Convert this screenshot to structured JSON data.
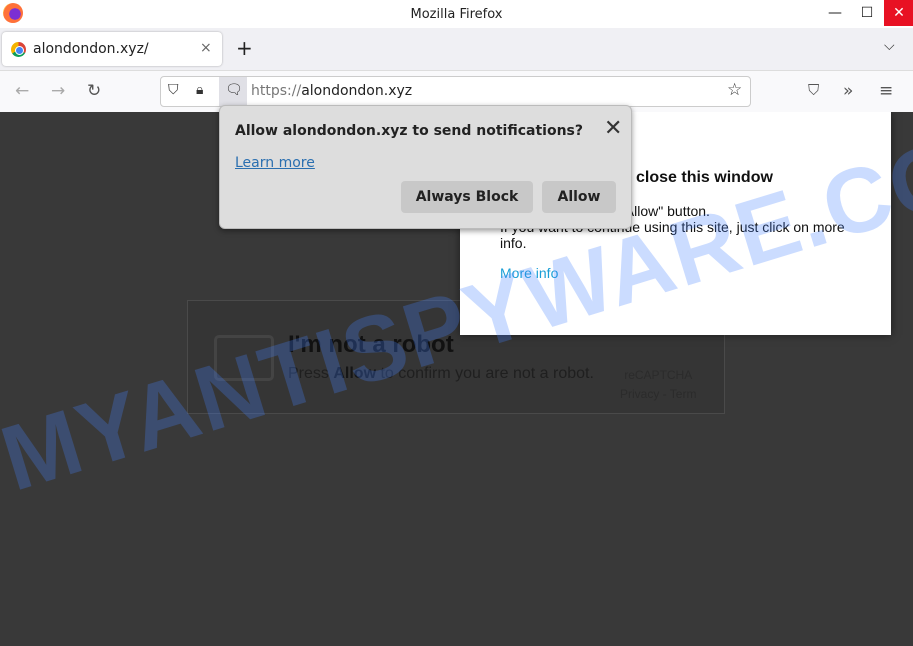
{
  "window": {
    "title": "Mozilla Firefox",
    "controls": {
      "minimize": "—",
      "maximize": "☐",
      "close": "✕"
    }
  },
  "tabs": [
    {
      "label": "alondondon.xyz/",
      "close": "×",
      "favicon": "chrome-icon"
    }
  ],
  "tabstrip": {
    "new_tab": "+",
    "list_all": "⌵"
  },
  "nav": {
    "back": "←",
    "forward": "→",
    "reload": "↻",
    "url_scheme": "https://",
    "url_host": "alondondon.xyz",
    "star": "☆",
    "pocket": "⛉",
    "overflow": "»",
    "menu": "≡"
  },
  "notification": {
    "title": "Allow alondondon.xyz to send notifications?",
    "learn_more": "Learn more",
    "block_label": "Always Block",
    "allow_label": "Allow",
    "close": "✕"
  },
  "popup": {
    "title": "close this window",
    "body_line1": "closed by pressing \"Allow\" button.",
    "body_line2": "If you want to continue using this site, just click on more info.",
    "more_info": "More info"
  },
  "captcha": {
    "title": "I'm not a robot",
    "sub_press": "Press ",
    "sub_allow": "Allow",
    "sub_rest": " to confirm you are not a robot.",
    "brand": "reCAPTCHA",
    "links": "Privacy - Term"
  },
  "watermark": "MYANTISPYWARE.COM"
}
